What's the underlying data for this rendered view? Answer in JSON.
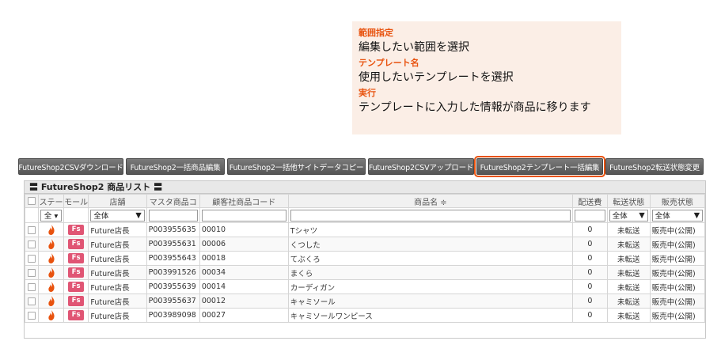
{
  "callout": {
    "range_head": "範囲指定",
    "range_text": "編集したい範囲を選択",
    "template_head": "テンプレート名",
    "template_text": "使用したいテンプレートを選択",
    "exec_head": "実行",
    "exec_text": "テンプレートに入力した情報が商品に移ります"
  },
  "toolbar": [
    "FutureShop2CSVダウンロード",
    "FutureShop2一括商品編集",
    "FutureShop2一括他サイトデータコピー",
    "FutureShop2CSVアップロード",
    "FutureShop2テンプレート一括編集",
    "FutureShop2転送状態変更"
  ],
  "grid": {
    "title": "〓 FutureShop2 商品リスト 〓",
    "columns": [
      "ステー",
      "モール",
      "店舗",
      "マスタ商品コ",
      "顧客社商品コード",
      "商品名 ≑",
      "配送費",
      "転送状態",
      "販売状態"
    ],
    "filters": {
      "status": "全 ▾",
      "shop": "全体",
      "transfer": "全体",
      "sale": "全体"
    },
    "rows": [
      {
        "shop": "Future店長",
        "master": "P003955635",
        "code": "00010",
        "name": "Tシャツ",
        "ship": "0",
        "transfer": "未転送",
        "sale": "販売中(公開)"
      },
      {
        "shop": "Future店長",
        "master": "P003955631",
        "code": "00006",
        "name": "くつした",
        "ship": "0",
        "transfer": "未転送",
        "sale": "販売中(公開)"
      },
      {
        "shop": "Future店長",
        "master": "P003955643",
        "code": "00018",
        "name": "てぶくろ",
        "ship": "0",
        "transfer": "未転送",
        "sale": "販売中(公開)"
      },
      {
        "shop": "Future店長",
        "master": "P003991526",
        "code": "00034",
        "name": "まくら",
        "ship": "0",
        "transfer": "未転送",
        "sale": "販売中(公開)"
      },
      {
        "shop": "Future店長",
        "master": "P003955639",
        "code": "00014",
        "name": "カーディガン",
        "ship": "0",
        "transfer": "未転送",
        "sale": "販売中(公開)"
      },
      {
        "shop": "Future店長",
        "master": "P003955637",
        "code": "00012",
        "name": "キャミソール",
        "ship": "0",
        "transfer": "未転送",
        "sale": "販売中(公開)"
      },
      {
        "shop": "Future店長",
        "master": "P003989098",
        "code": "00027",
        "name": "キャミソールワンピース",
        "ship": "0",
        "transfer": "未転送",
        "sale": "販売中(公開)"
      }
    ],
    "mall_badge": "Fs"
  },
  "colors": {
    "accent": "#e8520e",
    "badge": "#e05574",
    "button": "#6b6b6b"
  },
  "icons": {
    "status": "flame-icon",
    "dropdown": "chevron-down-icon"
  }
}
